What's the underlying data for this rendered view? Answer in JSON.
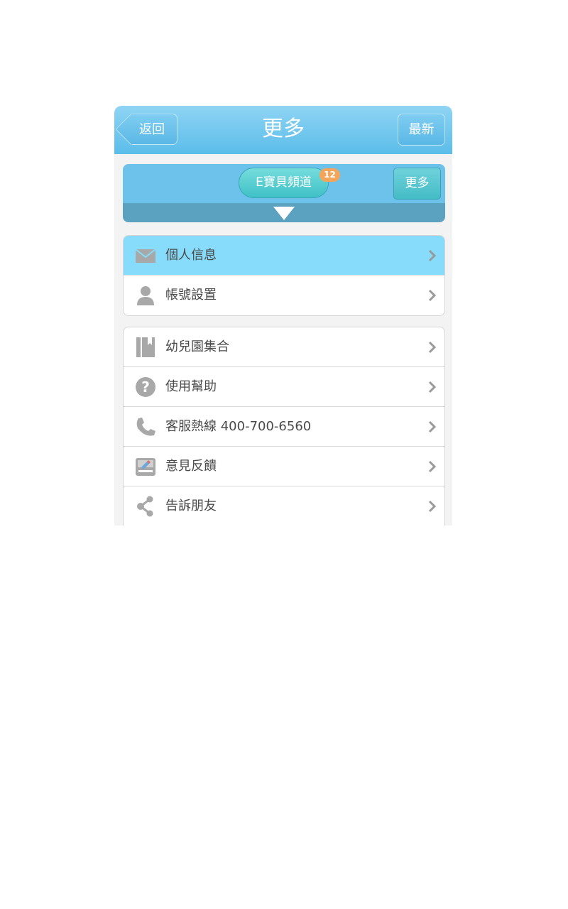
{
  "header": {
    "title": "更多",
    "back_label": "返回",
    "refresh_label": "最新"
  },
  "channel": {
    "name": "E寶貝頻道",
    "badge": "12",
    "more_label": "更多"
  },
  "menu_group_1": [
    {
      "label": "個人信息",
      "icon": "mail-icon",
      "active": true
    },
    {
      "label": "帳號設置",
      "icon": "person-icon"
    }
  ],
  "menu_group_2": [
    {
      "label": "幼兒園集合",
      "icon": "book-icon"
    },
    {
      "label": "使用幫助",
      "icon": "help-icon"
    },
    {
      "label": "客服熱線 400-700-6560",
      "icon": "phone-icon"
    },
    {
      "label": "意見反饋",
      "icon": "feedback-icon"
    },
    {
      "label": "告訴朋友",
      "icon": "share-icon"
    }
  ],
  "colors": {
    "header_blue": "#5bbde9",
    "active_row": "#86dcfa",
    "badge": "#f5a55a",
    "pill_teal": "#3fc1c6"
  }
}
